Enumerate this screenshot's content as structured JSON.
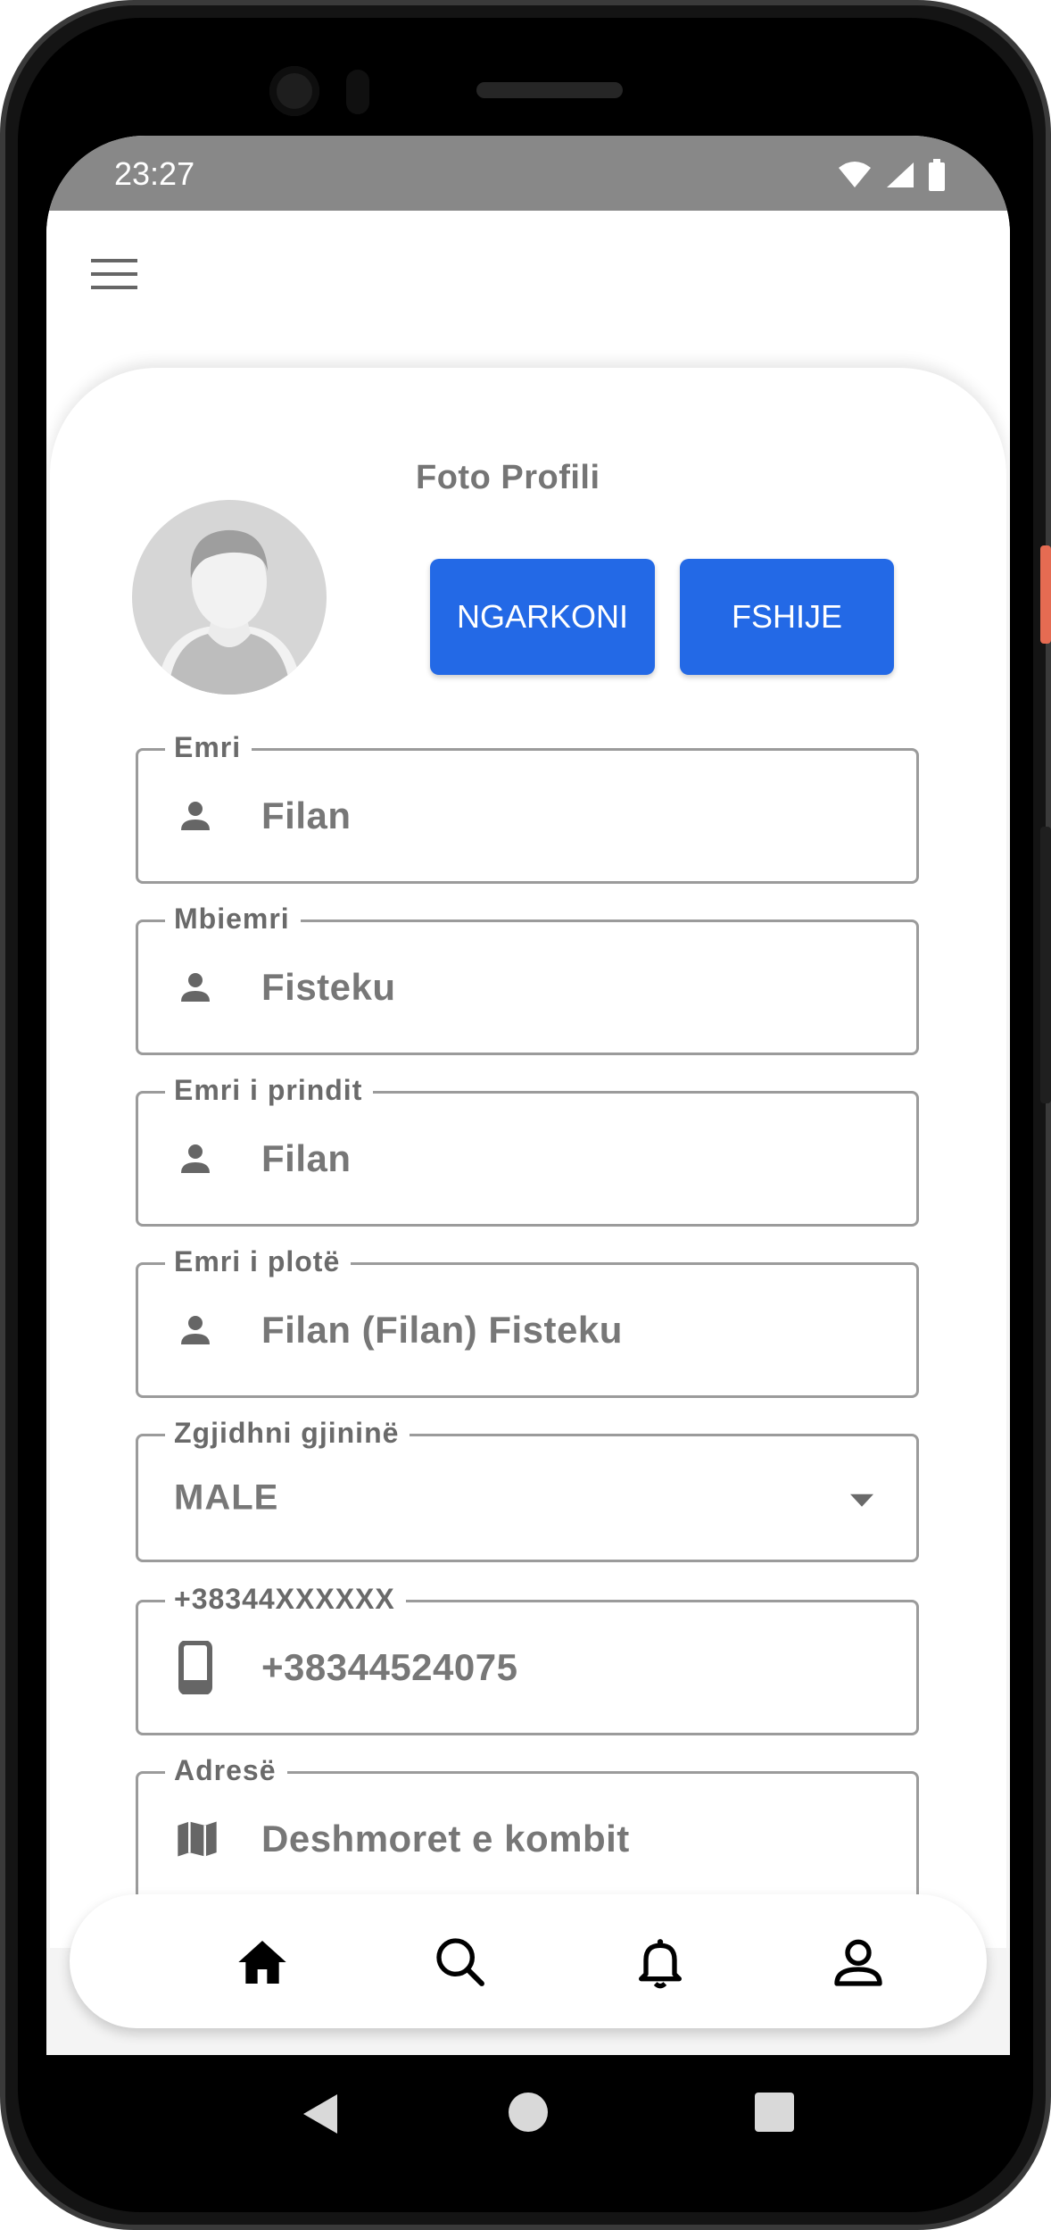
{
  "status_bar": {
    "time": "23:27"
  },
  "profile": {
    "photo_title": "Foto Profili",
    "upload_label": "NGARKONI",
    "delete_label": "FSHIJE"
  },
  "form": {
    "first_name": {
      "label": "Emri",
      "value": "Filan"
    },
    "last_name": {
      "label": "Mbiemri",
      "value": "Fisteku"
    },
    "parent_name": {
      "label": "Emri i prindit",
      "value": "Filan"
    },
    "full_name": {
      "label": "Emri i plotë",
      "value": "Filan (Filan) Fisteku"
    },
    "gender": {
      "label": "Zgjidhni gjininë",
      "value": "MALE"
    },
    "phone": {
      "label": "+38344XXXXXX",
      "value": "+38344524075"
    },
    "address": {
      "label": "Adresë",
      "value": "Deshmoret e kombit"
    }
  },
  "bottom_nav": {
    "items": [
      {
        "icon": "home-icon"
      },
      {
        "icon": "search-icon"
      },
      {
        "icon": "bell-icon"
      },
      {
        "icon": "user-icon"
      }
    ]
  },
  "colors": {
    "primary": "#2369e6",
    "statusbar": "#888888",
    "field_border": "#9b9b9b",
    "text_muted": "#777777"
  }
}
